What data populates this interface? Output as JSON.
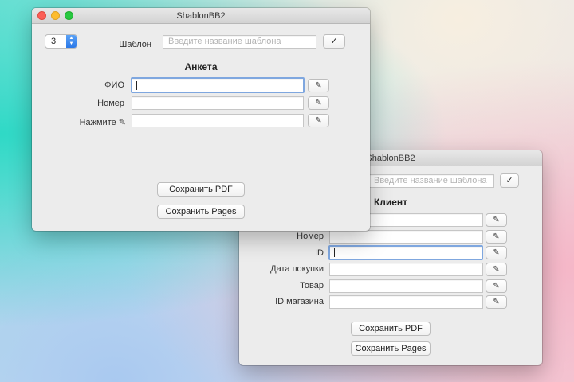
{
  "window_front": {
    "title": "ShablonBB2",
    "stepper_value": "3",
    "template_label": "Шаблон",
    "template_placeholder": "Введите название шаблона",
    "confirm_label": "✓",
    "section_title": "Анкета",
    "fields": [
      {
        "label": "ФИО",
        "value": ""
      },
      {
        "label": "Номер",
        "value": ""
      },
      {
        "label": "Нажмите ✎",
        "value": ""
      }
    ],
    "edit_label": "✎",
    "save_pdf": "Сохранить PDF",
    "save_pages": "Сохранить Pages"
  },
  "window_back": {
    "title": "ShablonBB2",
    "template_placeholder": "Введите название шаблона",
    "confirm_label": "✓",
    "section_title": "Клиент",
    "fields": [
      {
        "label": "",
        "value": ""
      },
      {
        "label": "Номер",
        "value": ""
      },
      {
        "label": "ID",
        "value": ""
      },
      {
        "label": "Дата покупки",
        "value": ""
      },
      {
        "label": "Товар",
        "value": ""
      },
      {
        "label": "ID магазина",
        "value": ""
      }
    ],
    "edit_label": "✎",
    "save_pdf": "Сохранить PDF",
    "save_pages": "Сохранить Pages"
  },
  "colors": {
    "focus_ring": "#7fa7df",
    "stepper_accent": "#2a78e8",
    "close": "#fc5f57",
    "minimize": "#fdbc2e",
    "zoom": "#28c840"
  },
  "icons": {
    "edit": "pencil-icon",
    "confirm": "checkmark-icon",
    "stepper": "chevron-up-down-icon"
  }
}
